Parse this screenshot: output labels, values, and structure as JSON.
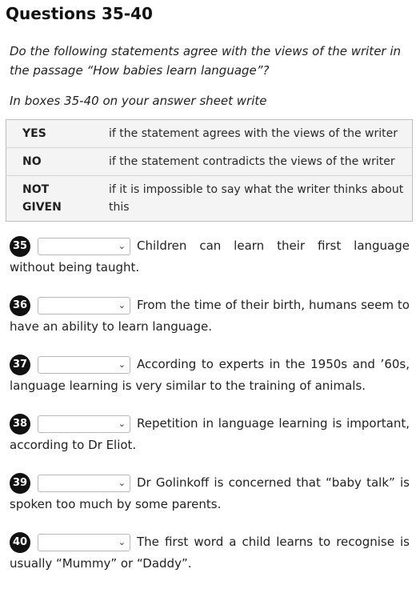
{
  "heading": "Questions 35-40",
  "intro": "Do the following statements agree with the views of the writer in the passage “How babies learn language”?",
  "instruction": "In boxes 35-40 on your answer sheet write",
  "key": [
    {
      "term": "YES",
      "definition": "if the statement agrees with the views of the writer"
    },
    {
      "term": "NO",
      "definition": "if the statement contradicts the views of the writer"
    },
    {
      "term": "NOT GIVEN",
      "definition": "if it is impossible to say what the writer thinks about this"
    }
  ],
  "questions": [
    {
      "number": "35",
      "selected": "",
      "text": "Children can learn their first language without being taught."
    },
    {
      "number": "36",
      "selected": "",
      "text": "From the time of their birth, humans seem to have an ability to learn language."
    },
    {
      "number": "37",
      "selected": "",
      "text": "According to experts in the 1950s and ’60s, language learning is very similar to the training of animals."
    },
    {
      "number": "38",
      "selected": "",
      "text": "Repetition in language learning is important, according to Dr Eliot."
    },
    {
      "number": "39",
      "selected": "",
      "text": "Dr Golinkoff is concerned that “baby talk” is spoken too much by some parents."
    },
    {
      "number": "40",
      "selected": "",
      "text": "The first word a child learns to recognise is usually “Mummy” or “Daddy”."
    }
  ]
}
